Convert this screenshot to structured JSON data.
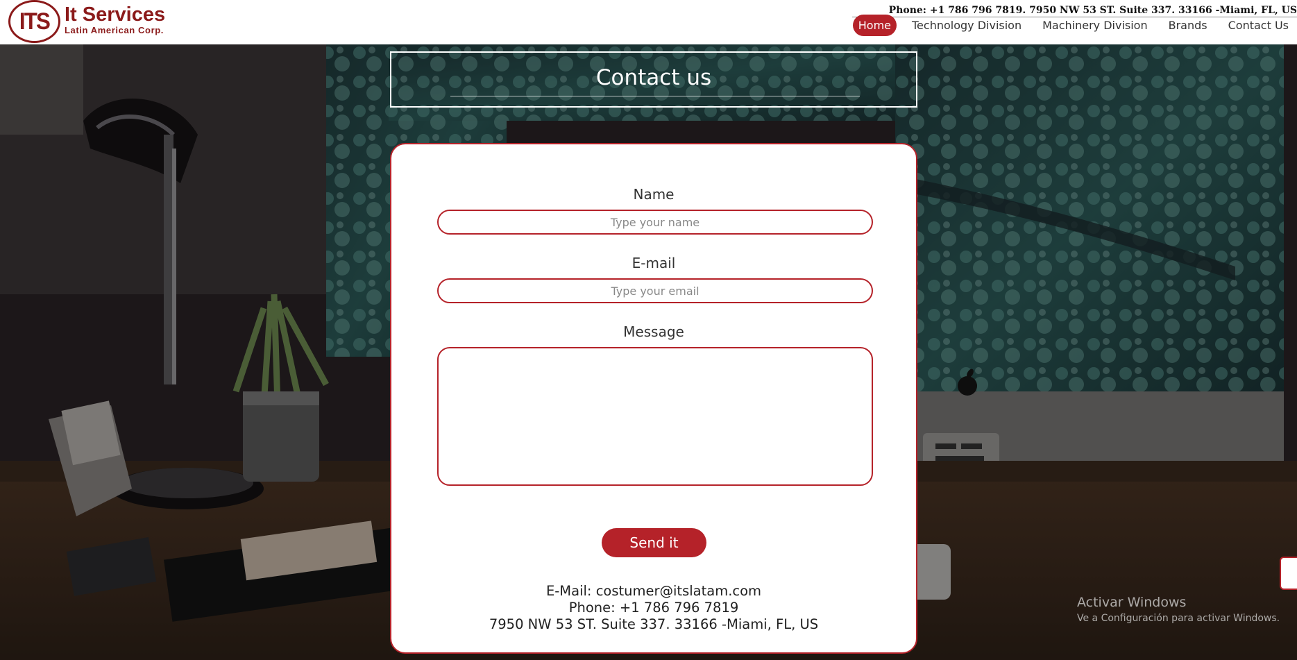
{
  "header": {
    "logo_text": "ITS",
    "brand_name": "It Services",
    "brand_sub": "Latin American Corp.",
    "contact_line": "Phone: +1 786 796 7819. 7950 NW 53 ST. Suite 337. 33166 -Miami, FL, US",
    "nav": [
      "Home",
      "Technology Division",
      "Machinery Division",
      "Brands",
      "Contact Us"
    ],
    "active_nav": "Home"
  },
  "page_title": "Contact us",
  "form": {
    "name_label": "Name",
    "name_placeholder": "Type your name",
    "email_label": "E-mail",
    "email_placeholder": "Type your email",
    "message_label": "Message",
    "message_value": "",
    "submit_label": "Send it"
  },
  "contact_info": {
    "email_line": "E-Mail: costumer@itslatam.com",
    "phone_line": "Phone: +1 786 796 7819",
    "address_line": "7950 NW 53 ST. Suite 337. 33166 -Miami, FL, US"
  },
  "windows_watermark": {
    "title": "Activar Windows",
    "subtitle": "Ve a Configuración para activar Windows."
  },
  "colors": {
    "brand": "#8b1a1a",
    "accent": "#b52229",
    "background_overlay": "#241d20"
  },
  "icons": [
    "its-logo-icon",
    "apple-logo-icon"
  ]
}
